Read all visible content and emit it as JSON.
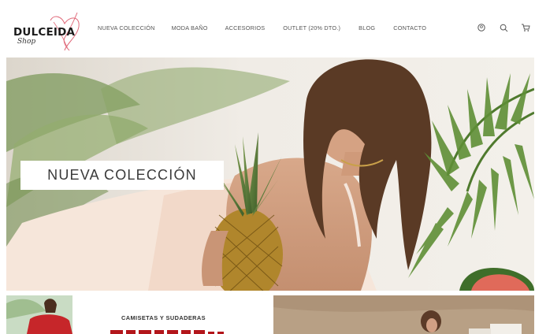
{
  "brand": {
    "name": "DULCEIDA",
    "sub": "Shop",
    "accent": "#e06a7a"
  },
  "nav": {
    "items": [
      {
        "label": "NUEVA COLECCIÓN"
      },
      {
        "label": "MODA BAÑO"
      },
      {
        "label": "ACCESORIOS"
      },
      {
        "label": "OUTLET (20% DTO.)"
      },
      {
        "label": "BLOG"
      },
      {
        "label": "CONTACTO"
      }
    ]
  },
  "header_icons": [
    "user-icon",
    "search-icon",
    "cart-icon"
  ],
  "hero": {
    "label": "NUEVA COLECCIÓN"
  },
  "promos": {
    "left": {
      "title": "CAMISETAS Y SUDADERAS",
      "color": "#b3161b"
    },
    "right": {
      "color": "#b59e85"
    }
  }
}
